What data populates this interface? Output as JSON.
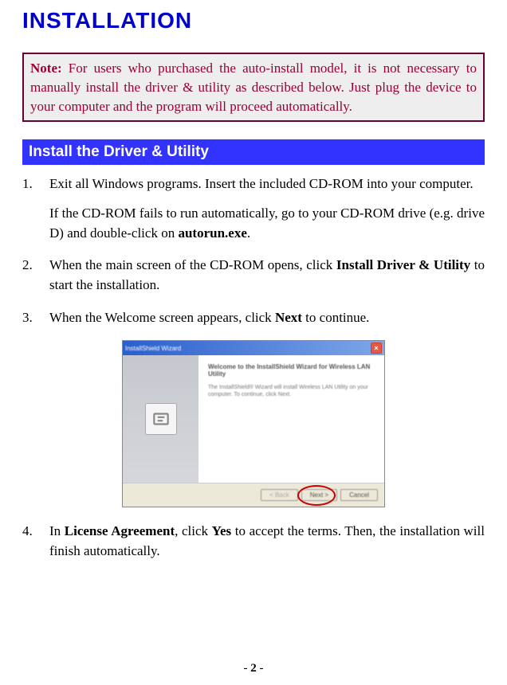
{
  "title": "INSTALLATION",
  "note": {
    "label": "Note:",
    "text": " For users who purchased the auto-install model, it is not necessary to manually install the driver & utility as described below. Just plug the device to your computer and the program will proceed automatically."
  },
  "section_header": "Install the Driver & Utility",
  "steps": {
    "s1": {
      "num": "1.",
      "p1a": "Exit all Windows programs. Insert the included CD-ROM into your computer.",
      "p2a": "If the CD-ROM fails to run automatically, go to your CD-ROM drive (e.g. drive D) and double-click on ",
      "p2b": "autorun.exe",
      "p2c": "."
    },
    "s2": {
      "num": "2.",
      "p1a": "When the main screen of the CD-ROM opens, click ",
      "p1b": "Install Driver & Utility",
      "p1c": " to start the installation."
    },
    "s3": {
      "num": "3.",
      "p1a": "When the Welcome screen appears, click ",
      "p1b": "Next",
      "p1c": " to continue."
    },
    "s4": {
      "num": "4.",
      "p1a": "In ",
      "p1b": "License Agreement",
      "p1c": ", click ",
      "p1d": "Yes",
      "p1e": " to accept the terms. Then, the installation will finish automatically."
    }
  },
  "wizard": {
    "title": "InstallShield Wizard",
    "heading": "Welcome to the InstallShield Wizard for Wireless LAN Utility",
    "body": "The InstallShield® Wizard will install Wireless LAN Utility on your computer. To continue, click Next.",
    "btn_back": "< Back",
    "btn_next": "Next >",
    "btn_cancel": "Cancel",
    "close": "×"
  },
  "page_number": "- 2 -"
}
